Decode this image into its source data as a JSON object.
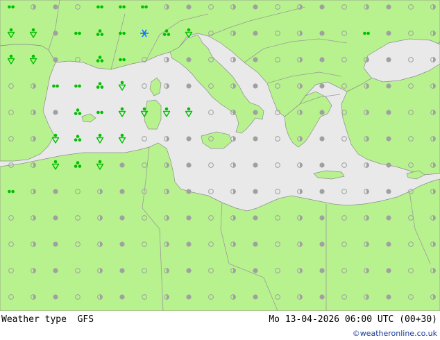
{
  "footer": {
    "title": "Weather type",
    "model": "GFS",
    "datetime": "Mo 13-04-2026 06:00 UTC (00+30)",
    "credit": "©weatheronline.co.uk"
  },
  "colors": {
    "land": "#b8f28e",
    "sea": "#e9e9e9",
    "border": "#9a9a9a",
    "coast": "#8c8c8c",
    "rain_symbol": "#00c000",
    "snow_symbol": "#1a78ff",
    "cloud_symbol": "#a0a0a0"
  },
  "symbols": [
    {
      "type": "drizzle",
      "col": 0,
      "row": 0
    },
    {
      "type": "drizzle",
      "col": 4,
      "row": 0
    },
    {
      "type": "drizzle",
      "col": 5,
      "row": 0
    },
    {
      "type": "drizzle",
      "col": 6,
      "row": 0
    },
    {
      "type": "rain-shower",
      "col": 0,
      "row": 1
    },
    {
      "type": "rain-shower",
      "col": 1,
      "row": 1
    },
    {
      "type": "drizzle",
      "col": 3,
      "row": 1
    },
    {
      "type": "rain-heavy",
      "col": 4,
      "row": 1
    },
    {
      "type": "drizzle",
      "col": 5,
      "row": 1
    },
    {
      "type": "snow",
      "col": 6,
      "row": 1
    },
    {
      "type": "rain-heavy",
      "col": 7,
      "row": 1
    },
    {
      "type": "rain-shower",
      "col": 8,
      "row": 1
    },
    {
      "type": "drizzle",
      "col": 16,
      "row": 1
    },
    {
      "type": "rain-shower",
      "col": 0,
      "row": 2
    },
    {
      "type": "rain-shower",
      "col": 1,
      "row": 2
    },
    {
      "type": "rain-heavy",
      "col": 4,
      "row": 2
    },
    {
      "type": "drizzle",
      "col": 5,
      "row": 2
    },
    {
      "type": "drizzle",
      "col": 2,
      "row": 3
    },
    {
      "type": "drizzle",
      "col": 3,
      "row": 3
    },
    {
      "type": "rain-heavy",
      "col": 4,
      "row": 3
    },
    {
      "type": "rain-shower",
      "col": 5,
      "row": 3
    },
    {
      "type": "rain-heavy",
      "col": 3,
      "row": 4
    },
    {
      "type": "drizzle",
      "col": 4,
      "row": 4
    },
    {
      "type": "rain-shower",
      "col": 5,
      "row": 4
    },
    {
      "type": "rain-shower",
      "col": 6,
      "row": 4
    },
    {
      "type": "rain-shower",
      "col": 7,
      "row": 4
    },
    {
      "type": "rain-shower",
      "col": 8,
      "row": 4
    },
    {
      "type": "rain-shower",
      "col": 2,
      "row": 5
    },
    {
      "type": "rain-heavy",
      "col": 3,
      "row": 5
    },
    {
      "type": "rain-shower",
      "col": 4,
      "row": 5
    },
    {
      "type": "rain-shower",
      "col": 5,
      "row": 5
    },
    {
      "type": "rain-shower",
      "col": 2,
      "row": 6
    },
    {
      "type": "rain-heavy",
      "col": 3,
      "row": 6
    },
    {
      "type": "rain-shower",
      "col": 4,
      "row": 6
    },
    {
      "type": "drizzle",
      "col": 0,
      "row": 7
    }
  ]
}
